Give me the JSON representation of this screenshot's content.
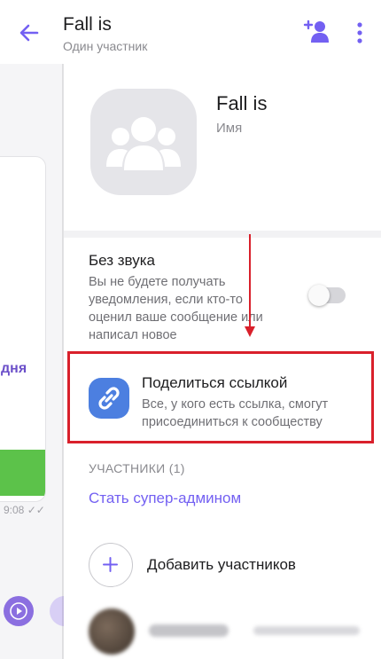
{
  "header": {
    "title": "Fall is",
    "subtitle": "Один участник"
  },
  "chat_background": {
    "snippet_text": "дня",
    "message_time": "9:08"
  },
  "group": {
    "name": "Fall is",
    "name_hint": "Имя"
  },
  "mute": {
    "title": "Без звука",
    "description": "Вы не будете получать уведомления, если кто-то оценил ваше сообщение или написал новое",
    "enabled": false
  },
  "share_link": {
    "title": "Поделиться ссылкой",
    "description": "Все, у кого есть ссылка, смогут присоединиться к сообществу"
  },
  "members": {
    "header": "УЧАСТНИКИ (1)",
    "make_super_admin": "Стать супер-админом",
    "add_members": "Добавить участников"
  },
  "colors": {
    "accent": "#7360f2",
    "highlight": "#d9202b",
    "share_icon": "#4c7fe0"
  }
}
